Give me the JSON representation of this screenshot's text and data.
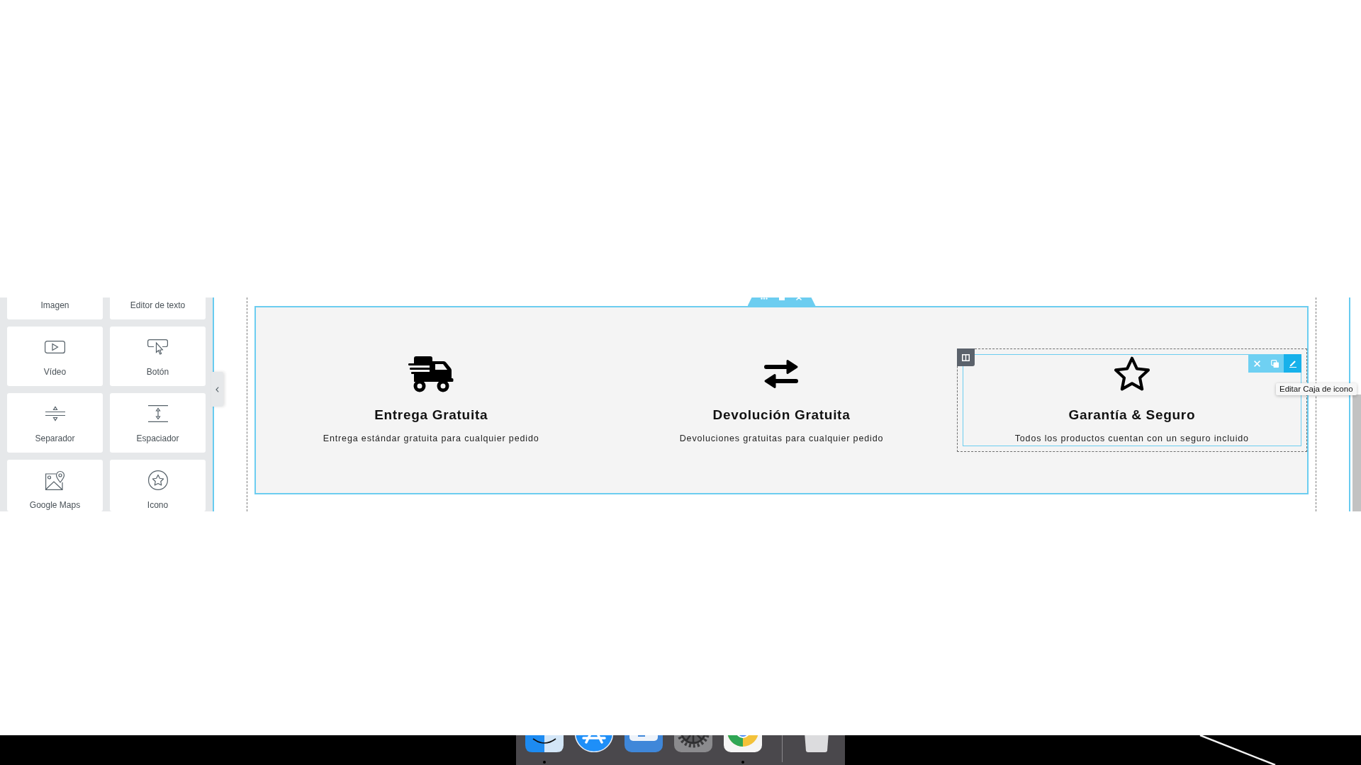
{
  "widget_panel": {
    "widgets": [
      {
        "label": "Imagen"
      },
      {
        "label": "Editor de texto"
      },
      {
        "label": "Vídeo",
        "kind": "video"
      },
      {
        "label": "Botón",
        "kind": "button"
      },
      {
        "label": "Separador",
        "kind": "divider"
      },
      {
        "label": "Espaciador",
        "kind": "spacer"
      },
      {
        "label": "Google Maps",
        "kind": "map"
      },
      {
        "label": "Icono",
        "kind": "star"
      }
    ]
  },
  "section": {
    "columns": [
      {
        "selected": false,
        "kind": "truck",
        "title": "Entrega Gratuita",
        "text": "Entrega estándar gratuita para cualquier pedido"
      },
      {
        "selected": false,
        "kind": "arrows",
        "title": "Devolución Gratuita",
        "text": "Devoluciones gratuitas para cualquier pedido"
      },
      {
        "selected": true,
        "kind": "star",
        "title": "Garantía & Seguro",
        "text": "Todos los productos cuentan con un seguro incluido"
      }
    ],
    "widget_toolbar": {
      "tools": [
        {
          "kind": "remove",
          "active": false
        },
        {
          "kind": "duplicate",
          "active": false
        },
        {
          "kind": "edit",
          "active": true,
          "tooltip": "Editar Caja de icono"
        }
      ]
    }
  },
  "dock": {
    "apps": [
      {
        "kind": "face",
        "running": true
      },
      {
        "kind": "store",
        "running": false
      },
      {
        "kind": "tile",
        "running": false
      },
      {
        "kind": "gear",
        "running": false
      },
      {
        "kind": "browser",
        "running": true
      },
      {
        "kind": "bin",
        "running": false
      }
    ]
  }
}
